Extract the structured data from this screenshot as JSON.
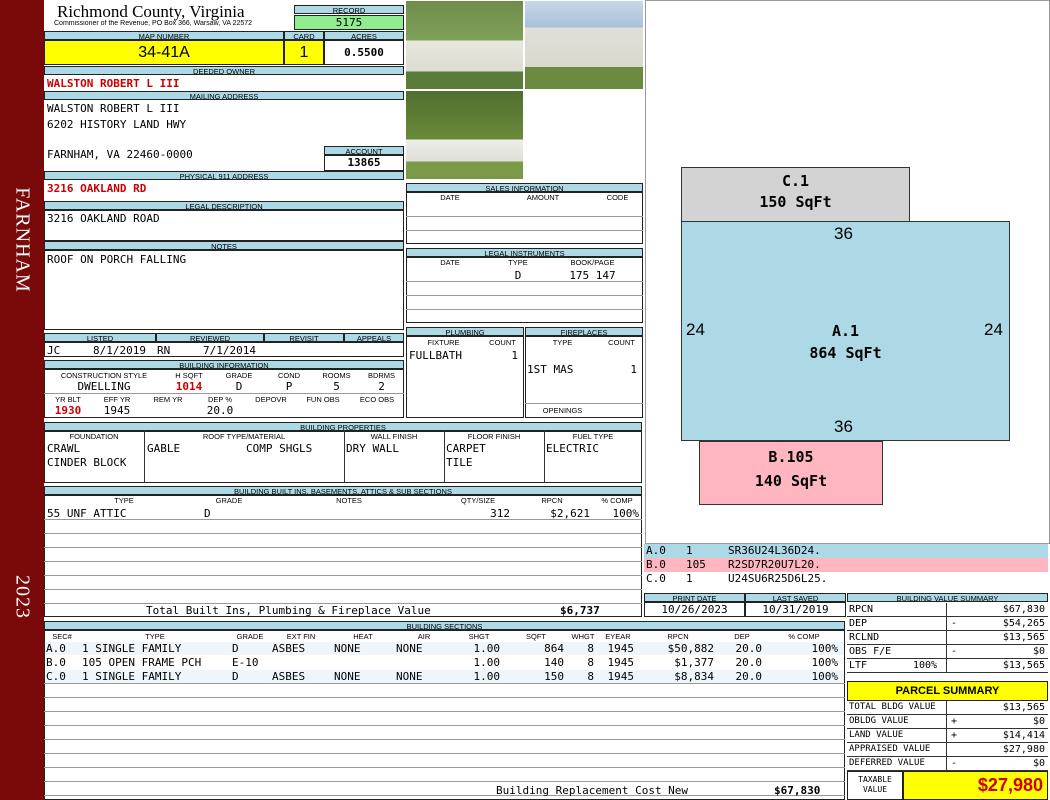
{
  "sidebar": {
    "city": "FARNHAM",
    "year": "2023"
  },
  "header": {
    "county": "Richmond County, Virginia",
    "commissioner": "Commissioner of the Revenue, PO Box 366, Warsaw, VA 22572",
    "record_label": "RECORD",
    "record": "5175",
    "map_number_label": "MAP NUMBER",
    "map_number": "34-41A",
    "card_label": "CARD",
    "card": "1",
    "acres_label": "ACRES",
    "acres": "0.5500"
  },
  "owner": {
    "deeded_owner_label": "DEEDED OWNER",
    "deeded_owner": "WALSTON ROBERT L III",
    "mailing_label": "MAILING ADDRESS",
    "mailing_line1": "WALSTON ROBERT L III",
    "mailing_line2": "6202 HISTORY LAND HWY",
    "mailing_line3": "FARNHAM, VA 22460-0000",
    "account_label": "ACCOUNT",
    "account": "13865",
    "physical_label": "PHYSICAL 911 ADDRESS",
    "physical": "3216 OAKLAND RD",
    "legal_label": "LEGAL DESCRIPTION",
    "legal": "3216 OAKLAND ROAD",
    "notes_label": "NOTES",
    "notes": "ROOF ON PORCH FALLING"
  },
  "listing": {
    "listed_label": "LISTED",
    "reviewed_label": "REVIEWED",
    "revisit_label": "REVISIT",
    "appeals_label": "APPEALS",
    "listed_by": "JC",
    "listed_date": "8/1/2019",
    "reviewed_by": "RN",
    "reviewed_date": "7/1/2014"
  },
  "building_info": {
    "title": "BUILDING INFORMATION",
    "headers": [
      "CONSTRUCTION STYLE",
      "H SQFT",
      "GRADE",
      "COND",
      "ROOMS",
      "BDRMS"
    ],
    "style": "DWELLING",
    "hsqft": "1014",
    "grade": "D",
    "cond": "P",
    "rooms": "5",
    "bdrms": "2",
    "headers2": [
      "YR BLT",
      "EFF YR",
      "REM YR",
      "DEP %",
      "DEPOVR",
      "FUN OBS",
      "ECO OBS"
    ],
    "yr_blt": "1930",
    "eff_yr": "1945",
    "dep": "20.0"
  },
  "sales": {
    "title": "SALES INFORMATION",
    "headers": [
      "DATE",
      "AMOUNT",
      "CODE"
    ]
  },
  "legal_instruments": {
    "title": "LEGAL INSTRUMENTS",
    "headers": [
      "DATE",
      "TYPE",
      "BOOK/PAGE"
    ],
    "type": "D",
    "bookpage": "175 147"
  },
  "plumbing": {
    "title": "PLUMBING",
    "headers": [
      "FIXTURE",
      "COUNT"
    ],
    "fixture": "FULLBATH",
    "count": "1"
  },
  "fireplaces": {
    "title": "FIREPLACES",
    "headers": [
      "TYPE",
      "COUNT"
    ],
    "type": "1ST MAS",
    "count": "1",
    "openings_label": "OPENINGS"
  },
  "properties": {
    "title": "BUILDING PROPERTIES",
    "headers": [
      "FOUNDATION",
      "ROOF TYPE/MATERIAL",
      "WALL FINISH",
      "FLOOR FINISH",
      "FUEL TYPE"
    ],
    "foundation1": "CRAWL",
    "foundation2": "CINDER BLOCK",
    "roof_type": "GABLE",
    "roof_material": "COMP SHGLS",
    "wall": "DRY WALL",
    "floor1": "CARPET",
    "floor2": "TILE",
    "fuel": "ELECTRIC"
  },
  "builtins": {
    "title": "BUILDING BUILT INS, BASEMENTS, ATTICS & SUB SECTIONS",
    "headers": [
      "TYPE",
      "GRADE",
      "NOTES",
      "QTY/SIZE",
      "RPCN",
      "% COMP"
    ],
    "row": {
      "type": "55 UNF ATTIC",
      "grade": "D",
      "qty": "312",
      "rpcn": "$2,621",
      "comp": "100%"
    },
    "total_label": "Total Built Ins, Plumbing & Fireplace Value",
    "total": "$6,737"
  },
  "print": {
    "print_label": "PRINT DATE",
    "saved_label": "LAST SAVED",
    "print_date": "10/26/2023",
    "last_saved": "10/31/2019"
  },
  "sections": {
    "title": "BUILDING SECTIONS",
    "headers": [
      "SEC#",
      "TYPE",
      "GRADE",
      "EXT FIN",
      "HEAT",
      "AIR",
      "SHGT",
      "SQFT",
      "WHGT",
      "EYEAR",
      "RPCN",
      "DEP",
      "% COMP"
    ],
    "rows": [
      {
        "sec": "A.0",
        "type": "1 SINGLE FAMILY",
        "grade": "D",
        "ext": "ASBES",
        "heat": "NONE",
        "air": "NONE",
        "shgt": "1.00",
        "sqft": "864",
        "whgt": "8",
        "eyear": "1945",
        "rpcn": "$50,882",
        "dep": "20.0",
        "comp": "100%"
      },
      {
        "sec": "B.0",
        "type": "105 OPEN FRAME PCH",
        "grade": "E-10",
        "ext": "",
        "heat": "",
        "air": "",
        "shgt": "1.00",
        "sqft": "140",
        "whgt": "8",
        "eyear": "1945",
        "rpcn": "$1,377",
        "dep": "20.0",
        "comp": "100%"
      },
      {
        "sec": "C.0",
        "type": "1 SINGLE FAMILY",
        "grade": "D",
        "ext": "ASBES",
        "heat": "NONE",
        "air": "NONE",
        "shgt": "1.00",
        "sqft": "150",
        "whgt": "8",
        "eyear": "1945",
        "rpcn": "$8,834",
        "dep": "20.0",
        "comp": "100%"
      }
    ],
    "replacement_label": "Building Replacement Cost New",
    "replacement": "$67,830"
  },
  "sketch": {
    "c_label": "C.1",
    "c_area": "150 SqFt",
    "a_label": "A.1",
    "a_area": "864 SqFt",
    "b_label": "B.105",
    "b_area": "140 SqFt",
    "dim_top": "36",
    "dim_bottom": "36",
    "dim_left": "24",
    "dim_right": "24",
    "legend": [
      {
        "code": "A.0",
        "n": "1",
        "path": "SR36U24L36D24.",
        "color": "#add8e6"
      },
      {
        "code": "B.0",
        "n": "105",
        "path": "R2SD7R20U7L20.",
        "color": "#ffb6c1"
      },
      {
        "code": "C.0",
        "n": "1",
        "path": "U24SU6R25D6L25.",
        "color": "#ffffff"
      }
    ]
  },
  "value_summary": {
    "title": "BUILDING VALUE SUMMARY",
    "rpcn_label": "RPCN",
    "rpcn": "$67,830",
    "dep_label": "DEP",
    "dep_sign": "-",
    "dep": "$54,265",
    "rclnd_label": "RCLND",
    "rclnd": "$13,565",
    "obs_label": "OBS F/E",
    "obs_sign": "-",
    "obs": "$0",
    "ltf_label": "LTF",
    "ltf_pct": "100%",
    "ltf": "$13,565"
  },
  "parcel": {
    "title": "PARCEL SUMMARY",
    "total_bldg_label": "TOTAL BLDG VALUE",
    "total_bldg": "$13,565",
    "obldg_label": "OBLDG VALUE",
    "obldg_sign": "+",
    "obldg": "$0",
    "land_label": "LAND VALUE",
    "land_sign": "+",
    "land": "$14,414",
    "appraised_label": "APPRAISED VALUE",
    "appraised": "$27,980",
    "deferred_label": "DEFERRED VALUE",
    "deferred_sign": "-",
    "deferred": "$0",
    "taxable_label1": "TAXABLE",
    "taxable_label2": "VALUE",
    "taxable": "$27,980"
  },
  "colors": {
    "header_blue": "#add8e6",
    "yellow": "#ffff00",
    "green": "#90ee90",
    "maroon": "#7a0a0a",
    "pink": "#ffb6c1",
    "gray": "#d3d3d3"
  }
}
